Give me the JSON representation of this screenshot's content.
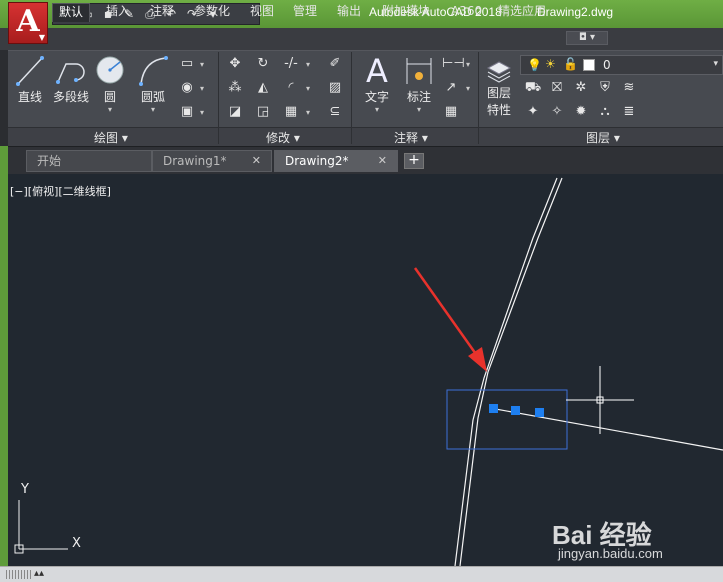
{
  "window": {
    "app_title": "Autodesk AutoCAD 2018",
    "file_title": "Drawing2.dwg"
  },
  "app_button": {
    "letter": "A",
    "icon": "autocad-logo-icon"
  },
  "quick_access": [
    "new-icon",
    "open-icon",
    "save-icon",
    "saveas-icon",
    "print-icon",
    "undo-icon",
    "redo-icon",
    "customize-icon"
  ],
  "tabs": [
    "默认",
    "插入",
    "注释",
    "参数化",
    "视图",
    "管理",
    "输出",
    "附加模块",
    "A360",
    "精选应用"
  ],
  "active_tab": "默认",
  "draw_panel": {
    "title": "绘图",
    "line_label": "直线",
    "polyline_label": "多段线",
    "circle_label": "圆",
    "arc_label": "圆弧"
  },
  "modify_panel": {
    "title": "修改"
  },
  "annotation_panel": {
    "title": "注释",
    "text_label": "文字",
    "dim_label": "标注",
    "text_glyph": "A"
  },
  "layers_panel": {
    "title": "图层",
    "props_line1": "图层",
    "props_line2": "特性",
    "current_layer": "0"
  },
  "doc_tabs": [
    {
      "label": "开始"
    },
    {
      "label": "Drawing1*"
    },
    {
      "label": "Drawing2*"
    }
  ],
  "doc_tab_close": "✕",
  "new_tab": "+",
  "viewport_label": "[−][俯视][二维线框]",
  "ucs": {
    "x": "X",
    "y": "Y"
  },
  "watermark": {
    "logo": "Bai 经验",
    "url": "jingyan.baidu.com"
  },
  "colors": {
    "title_bar": "#5f9c3b",
    "canvas": "#212830",
    "selection_box": "#3d6fd8",
    "grip": "#1e7ff0",
    "arrow": "#e8322c"
  }
}
